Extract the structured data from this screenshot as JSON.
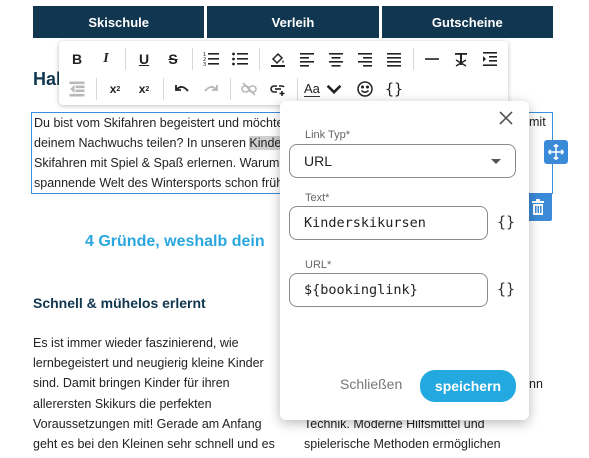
{
  "nav": {
    "items": [
      "Skischule",
      "Verleih",
      "Gutscheine"
    ]
  },
  "page": {
    "heading_fragment": "Hal",
    "intro_lines": [
      "Du bist vom Skifahren begeistert und möchtest",
      "deinem Nachwuchs teilen? In unseren ",
      "Skifahren mit Spiel & Spaß erlernen. Warum",
      "spannende Welt des Wintersports schon früh"
    ],
    "intro_highlight": "Kinde",
    "intro_right_fragments": [
      "mit"
    ],
    "section_title": "4 Gründe, weshalb dein",
    "subheading": "Schnell & mühelos erlernt",
    "column_left_lines": [
      "Es ist immer wieder faszinierend, wie",
      "lernbegeistert und neugierig kleine Kinder",
      "sind. Damit bringen Kinder für ihren",
      "allerersten Skikurs die perfekten",
      "Voraussetzungen mit! Gerade am Anfang",
      "geht es bei den Kleinen sehr schnell und es"
    ],
    "column_right_fragment": "nn",
    "column_right_lines": [
      "Technik. Moderne Hilfsmittel und",
      "spielerische Methoden ermöglichen"
    ]
  },
  "toolbar": {
    "font_size_label": "Aa",
    "icons_row1": [
      "bold-icon",
      "italic-icon",
      "underline-icon",
      "strikethrough-icon",
      "ordered-list-icon",
      "bullet-list-icon",
      "fill-color-icon",
      "align-left-icon",
      "align-center-icon",
      "align-right-icon",
      "align-justify-icon",
      "horizontal-line-icon",
      "clear-format-icon",
      "indent-icon"
    ],
    "icons_row2": [
      "outdent-icon",
      "superscript-icon",
      "subscript-icon",
      "undo-icon",
      "redo-icon",
      "unlink-icon",
      "insert-link-icon",
      "font-size-icon",
      "emoji-icon",
      "code-icon"
    ]
  },
  "dialog": {
    "link_type_label": "Link Typ*",
    "link_type_value": "URL",
    "text_label": "Text*",
    "text_value": "Kinderskikursen",
    "url_label": "URL*",
    "url_value": "${bookinglink}",
    "variable_icon": "{}",
    "close_label": "Schließen",
    "save_label": "speichern"
  },
  "colors": {
    "nav_bg": "#103650",
    "accent": "#24a8e0",
    "selection_border": "#3d8fd6",
    "heading_blue": "#2aa7df"
  }
}
